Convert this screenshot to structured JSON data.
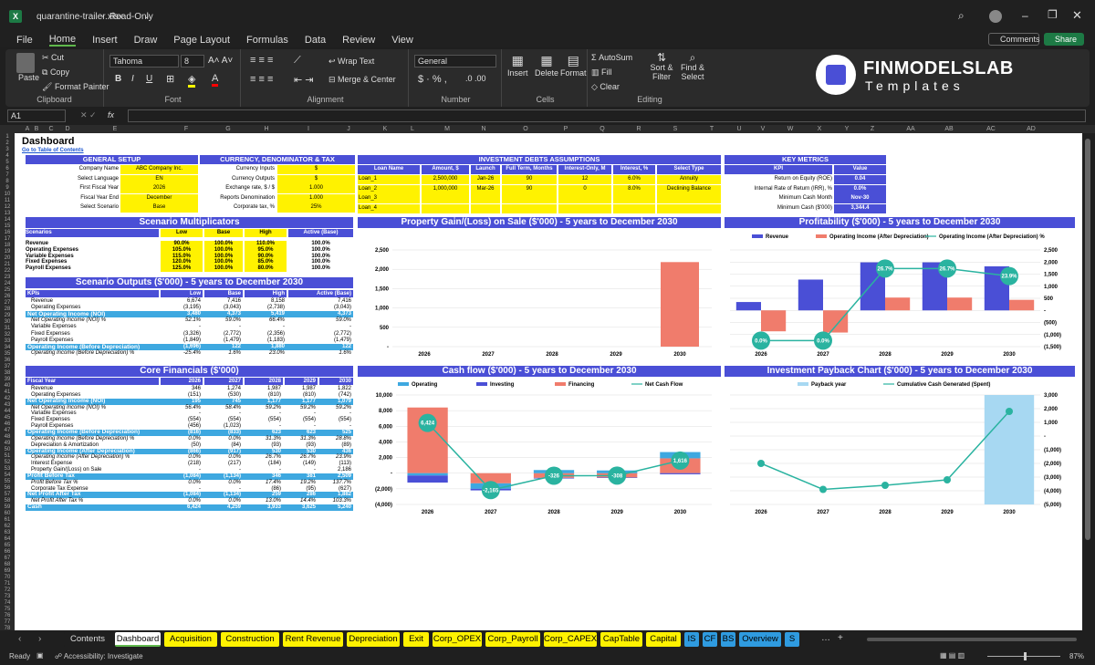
{
  "window": {
    "filename": "quarantine-trailer.xlsx",
    "mode": "Read-Only"
  },
  "menu": [
    "File",
    "Home",
    "Insert",
    "Draw",
    "Page Layout",
    "Formulas",
    "Data",
    "Review",
    "View"
  ],
  "menu_active": "Home",
  "topright": {
    "comments": "Comments",
    "share": "Share"
  },
  "ribbon": {
    "clipboard": {
      "paste": "Paste",
      "cut": "Cut",
      "copy": "Copy",
      "format_painter": "Format Painter",
      "label": "Clipboard"
    },
    "font": {
      "name": "Tahoma",
      "size": "8",
      "label": "Font"
    },
    "alignment": {
      "wrap": "Wrap Text",
      "merge": "Merge & Center",
      "label": "Alignment"
    },
    "number": {
      "format": "General",
      "label": "Number"
    },
    "cells": {
      "insert": "Insert",
      "delete": "Delete",
      "format": "Format",
      "label": "Cells"
    },
    "editing": {
      "autosum": "AutoSum",
      "fill": "Fill",
      "clear": "Clear",
      "sort": "Sort & Filter",
      "find": "Find & Select",
      "label": "Editing"
    },
    "logo": {
      "line1": "FINMODELSLAB",
      "line2": "Templates"
    }
  },
  "formula": {
    "namebox": "A1",
    "fx": "fx"
  },
  "columns": [
    "A",
    "B",
    "C",
    "D",
    "E",
    "F",
    "G",
    "H",
    "I",
    "J",
    "K",
    "L",
    "M",
    "N",
    "O",
    "P",
    "Q",
    "R",
    "S",
    "T",
    "U",
    "V",
    "W",
    "X",
    "Y",
    "Z",
    "AA",
    "AB",
    "AC",
    "AD"
  ],
  "sheet": {
    "title": "Dashboard",
    "link": "Go to Table of Contents",
    "general_setup": {
      "header": "GENERAL SETUP",
      "rows": [
        [
          "Company Name",
          "ABC Company Inc."
        ],
        [
          "Select Language",
          "EN"
        ],
        [
          "First Fiscal Year",
          "2026"
        ],
        [
          "Fiscal Year End",
          "December"
        ],
        [
          "Select Scenario",
          "Base"
        ]
      ]
    },
    "currency": {
      "header": "CURRENCY, DENOMINATOR & TAX",
      "rows": [
        [
          "Currency Inputs",
          "$"
        ],
        [
          "Currency Outputs",
          "$"
        ],
        [
          "Exchange rate, $ / $",
          "1.000"
        ],
        [
          "Reports Denomination",
          "1.000"
        ],
        [
          "Corporate tax, %",
          "25%"
        ]
      ]
    },
    "debts": {
      "header": "INVESTMENT DEBTS ASSUMPTIONS",
      "cols": [
        "Loan Name",
        "Amount, $",
        "Launch",
        "Full Term, Months",
        "Interest-Only, M",
        "Interest, %",
        "Select Type"
      ],
      "rows": [
        [
          "Loan_1",
          "2,500,000",
          "Jan-26",
          "90",
          "12",
          "6.0%",
          "Annuity"
        ],
        [
          "Loan_2",
          "1,000,000",
          "Mar-26",
          "90",
          "0",
          "8.0%",
          "Declining Balance"
        ],
        [
          "Loan_3",
          "",
          "",
          "",
          "",
          "",
          ""
        ],
        [
          "Loan_4",
          "",
          "",
          "",
          "",
          "",
          ""
        ]
      ]
    },
    "key_metrics": {
      "header": "KEY METRICS",
      "cols": [
        "KPI",
        "Value"
      ],
      "rows": [
        [
          "Return on Equity (ROE)",
          "0.04"
        ],
        [
          "Internal Rate of Return (IRR), %",
          "0.0%"
        ],
        [
          "Minimum Cash Month",
          "Nov-30"
        ],
        [
          "Minimum Cash ($'000)",
          "3,344.4"
        ]
      ]
    },
    "scenario_mult": {
      "header": "Scenario Multiplicators",
      "cols": [
        "Scenarios",
        "Low",
        "Base",
        "High",
        "Active (Base)"
      ],
      "rows": [
        [
          "Revenue",
          "90.0%",
          "100.0%",
          "110.0%",
          "100.0%"
        ],
        [
          "Operating Expenses",
          "105.0%",
          "100.0%",
          "95.0%",
          "100.0%"
        ],
        [
          "Variable Expenses",
          "115.0%",
          "100.0%",
          "90.0%",
          "100.0%"
        ],
        [
          "Fixed Expenses",
          "120.0%",
          "100.0%",
          "85.0%",
          "100.0%"
        ],
        [
          "Payroll Expenses",
          "125.0%",
          "100.0%",
          "80.0%",
          "100.0%"
        ]
      ]
    },
    "scenario_out": {
      "header": "Scenario Outputs ($'000) - 5 years to December 2030",
      "cols": [
        "KPIs",
        "Low",
        "Base",
        "High",
        "Active (Base)"
      ],
      "rows": [
        {
          "k": "Revenue",
          "v": [
            "6,674",
            "7,416",
            "8,158",
            "7,416"
          ],
          "s": "n"
        },
        {
          "k": "Operating Expenses",
          "v": [
            "(3,195)",
            "(3,043)",
            "(2,738)",
            "(3,043)"
          ],
          "s": "n"
        },
        {
          "k": "Net Operating Income (NOI)",
          "v": [
            "3,480",
            "4,373",
            "5,419",
            "4,373"
          ],
          "s": "h"
        },
        {
          "k": "Net Operating Income (NOI) %",
          "v": [
            "52.1%",
            "59.0%",
            "66.4%",
            "59.0%"
          ],
          "s": "i"
        },
        {
          "k": "Variable Expenses",
          "v": [
            "-",
            "-",
            "-",
            "-"
          ],
          "s": "n"
        },
        {
          "k": "Fixed Expenses",
          "v": [
            "(3,326)",
            "(2,772)",
            "(2,356)",
            "(2,772)"
          ],
          "s": "n"
        },
        {
          "k": "Payroll Expenses",
          "v": [
            "(1,849)",
            "(1,479)",
            "(1,183)",
            "(1,479)"
          ],
          "s": "n"
        },
        {
          "k": "Operating Income (Before Depreciation)",
          "v": [
            "(1,696)",
            "122",
            "1,880",
            "122"
          ],
          "s": "h"
        },
        {
          "k": "Operating Income (Before Depreciation) %",
          "v": [
            "-25.4%",
            "1.6%",
            "23.0%",
            "1.6%"
          ],
          "s": "i"
        }
      ]
    },
    "core": {
      "header": "Core Financials ($'000)",
      "cols": [
        "Fiscal Year",
        "2026",
        "2027",
        "2028",
        "2029",
        "2030"
      ],
      "rows": [
        {
          "k": "Revenue",
          "v": [
            "346",
            "1,274",
            "1,987",
            "1,987",
            "1,822"
          ],
          "s": "n"
        },
        {
          "k": "Operating Expenses",
          "v": [
            "(151)",
            "(530)",
            "(810)",
            "(810)",
            "(742)"
          ],
          "s": "n"
        },
        {
          "k": "Net Operating Income (NOI)",
          "v": [
            "195",
            "745",
            "1,177",
            "1,177",
            "1,079"
          ],
          "s": "h"
        },
        {
          "k": "Net Operating Income (NOI) %",
          "v": [
            "56.4%",
            "58.4%",
            "59.2%",
            "59.2%",
            "59.2%"
          ],
          "s": "i"
        },
        {
          "k": "Variable Expenses",
          "v": [
            "-",
            "-",
            "-",
            "-",
            "-"
          ],
          "s": "n"
        },
        {
          "k": "Fixed Expenses",
          "v": [
            "(554)",
            "(554)",
            "(554)",
            "(554)",
            "(554)"
          ],
          "s": "n"
        },
        {
          "k": "Payroll Expenses",
          "v": [
            "(456)",
            "(1,023)",
            "-",
            "-",
            "-"
          ],
          "s": "n"
        },
        {
          "k": "Operating Income (Before Depreciation)",
          "v": [
            "(816)",
            "(833)",
            "623",
            "623",
            "525"
          ],
          "s": "h"
        },
        {
          "k": "Operating Income (Before Depreciation) %",
          "v": [
            "0.0%",
            "0.0%",
            "31.3%",
            "31.3%",
            "28.8%"
          ],
          "s": "i"
        },
        {
          "k": "Depreciation & Amortization",
          "v": [
            "(50)",
            "(84)",
            "(93)",
            "(93)",
            "(89)"
          ],
          "s": "n"
        },
        {
          "k": "Operating Income (After Depreciation)",
          "v": [
            "(866)",
            "(917)",
            "530",
            "530",
            "436"
          ],
          "s": "h"
        },
        {
          "k": "Operating Income (After Depreciation) %",
          "v": [
            "0.0%",
            "0.0%",
            "26.7%",
            "26.7%",
            "23.9%"
          ],
          "s": "i"
        },
        {
          "k": "Interest Expense",
          "v": [
            "(218)",
            "(217)",
            "(184)",
            "(149)",
            "(113)"
          ],
          "s": "n"
        },
        {
          "k": "Property Gain/(Loss) on Sale",
          "v": [
            "-",
            "-",
            "-",
            "-",
            "2,186"
          ],
          "s": "n"
        },
        {
          "k": "Profit Before Tax",
          "v": [
            "(1,084)",
            "(1,134)",
            "346",
            "381",
            "2,509"
          ],
          "s": "h"
        },
        {
          "k": "Profit Before Tax %",
          "v": [
            "0.0%",
            "0.0%",
            "17.4%",
            "19.2%",
            "137.7%"
          ],
          "s": "i"
        },
        {
          "k": "Corporate Tax Expense",
          "v": [
            "-",
            "-",
            "(86)",
            "(95)",
            "(627)"
          ],
          "s": "n"
        },
        {
          "k": "Net Profit After Tax",
          "v": [
            "(1,084)",
            "(1,134)",
            "259",
            "286",
            "1,882"
          ],
          "s": "h"
        },
        {
          "k": "Net Profit After Tax %",
          "v": [
            "0.0%",
            "0.0%",
            "13.0%",
            "14.4%",
            "103.3%"
          ],
          "s": "i"
        },
        {
          "k": "Cash",
          "v": [
            "6,424",
            "4,259",
            "3,933",
            "3,625",
            "5,240"
          ],
          "s": "h"
        }
      ]
    }
  },
  "chart_data": [
    {
      "type": "bar",
      "title": "Property Gain/(Loss) on Sale ($'000) - 5 years to December 2030",
      "categories": [
        "2026",
        "2027",
        "2028",
        "2029",
        "2030"
      ],
      "values": [
        0,
        0,
        0,
        0,
        2186
      ],
      "ylim": [
        0,
        2500
      ],
      "yticks": [
        "-",
        "500",
        "1,000",
        "1,500",
        "2,000",
        "2,500"
      ],
      "color": "#f07c6c"
    },
    {
      "type": "bar",
      "title": "Profitability ($'000) - 5 years to December 2030",
      "categories": [
        "2026",
        "2027",
        "2028",
        "2029",
        "2030"
      ],
      "series": [
        {
          "name": "Revenue",
          "values": [
            346,
            1274,
            1987,
            1987,
            1822
          ],
          "color": "#4a4fd6"
        },
        {
          "name": "Operating Income (After Depreciation)",
          "values": [
            -866,
            -917,
            530,
            530,
            436
          ],
          "color": "#f07c6c"
        },
        {
          "name": "Operating Income (After Depreciation) %",
          "values": [
            0.0,
            0.0,
            26.7,
            26.7,
            23.9
          ],
          "labels": [
            "0.0%",
            "0.0%",
            "26.7%",
            "26.7%",
            "23.9%"
          ],
          "color": "#2ab3a0"
        }
      ],
      "yticks_left": [
        "(1,500)",
        "(1,000)",
        "(500)",
        "-",
        "500",
        "1,000",
        "1,500",
        "2,000",
        "2,500"
      ],
      "ylim": [
        -1500,
        2500
      ]
    },
    {
      "type": "bar",
      "title": "Cash flow ($'000) - 5 years to December 2030",
      "categories": [
        "2026",
        "2027",
        "2028",
        "2029",
        "2030"
      ],
      "series": [
        {
          "name": "Operating",
          "values": [
            -300,
            -700,
            400,
            350,
            800
          ],
          "color": "#3ea8e0"
        },
        {
          "name": "Investing",
          "values": [
            -900,
            -200,
            -80,
            -60,
            -140
          ],
          "color": "#4a4fd6"
        },
        {
          "name": "Financing",
          "values": [
            8400,
            -1300,
            -600,
            -550,
            1900
          ],
          "color": "#f07c6c"
        },
        {
          "name": "Net Cash Flow",
          "values": [
            6424,
            -2165,
            -326,
            -308,
            1616
          ],
          "labels": [
            "6,424",
            "-2,165",
            "-326",
            "-308",
            "1,616"
          ],
          "color": "#2ab3a0"
        }
      ],
      "yticks": [
        "(4,000)",
        "(2,000)",
        "-",
        "2,000",
        "4,000",
        "6,000",
        "8,000",
        "10,000"
      ],
      "ylim": [
        -4000,
        10000
      ]
    },
    {
      "type": "bar",
      "title": "Investment Payback Chart ($'000) - 5 years to December 2030",
      "categories": [
        "2026",
        "2027",
        "2028",
        "2029",
        "2030"
      ],
      "series": [
        {
          "name": "Payback year",
          "values": [
            0,
            0,
            0,
            0,
            1
          ],
          "color": "#a7d8f2"
        },
        {
          "name": "Cumulative Cash Generated (Spent)",
          "values": [
            -2000,
            -3900,
            -3600,
            -3200,
            1800
          ],
          "color": "#2ab3a0"
        }
      ],
      "yticks": [
        "(5,000)",
        "(4,000)",
        "(3,000)",
        "(2,000)",
        "(1,000)",
        "-",
        "1,000",
        "2,000",
        "3,000"
      ],
      "ylim": [
        -5000,
        3000
      ]
    }
  ],
  "tabs": [
    {
      "label": "Contents",
      "style": "d"
    },
    {
      "label": "Dashboard",
      "style": "active"
    },
    {
      "label": "Acquisition",
      "style": "y"
    },
    {
      "label": "Construction",
      "style": "y"
    },
    {
      "label": "Rent Revenue",
      "style": "y"
    },
    {
      "label": "Depreciation",
      "style": "y"
    },
    {
      "label": "Exit",
      "style": "y"
    },
    {
      "label": "Corp_OPEX",
      "style": "y"
    },
    {
      "label": "Corp_Payroll",
      "style": "y"
    },
    {
      "label": "Corp_CAPEX",
      "style": "y"
    },
    {
      "label": "CapTable",
      "style": "y"
    },
    {
      "label": "Capital",
      "style": "y"
    },
    {
      "label": "IS",
      "style": "b"
    },
    {
      "label": "CF",
      "style": "b"
    },
    {
      "label": "BS",
      "style": "b"
    },
    {
      "label": "Overview",
      "style": "b"
    },
    {
      "label": "S",
      "style": "b"
    }
  ],
  "status": {
    "ready": "Ready",
    "accessibility": "Accessibility: Investigate",
    "zoom": "87%"
  }
}
